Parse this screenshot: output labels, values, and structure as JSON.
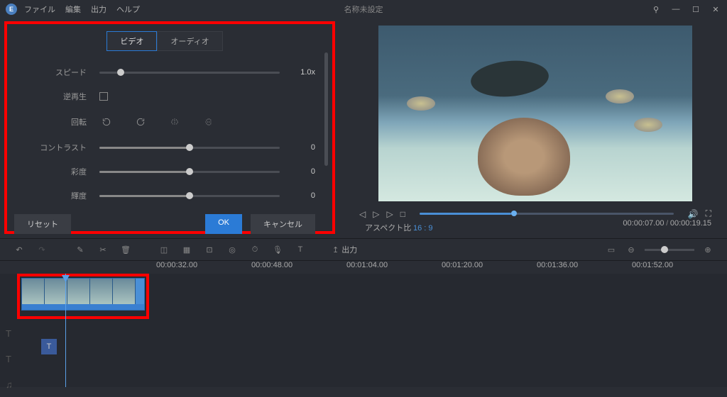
{
  "titlebar": {
    "logo": "E",
    "menu": [
      "ファイル",
      "編集",
      "出力",
      "ヘルプ"
    ],
    "title": "名称未設定"
  },
  "panel": {
    "tabs": {
      "video": "ビデオ",
      "audio": "オーディオ"
    },
    "labels": {
      "speed": "スピード",
      "reverse": "逆再生",
      "rotate": "回転",
      "contrast": "コントラスト",
      "saturation": "彩度",
      "brightness": "輝度"
    },
    "speed_val": "1.0x",
    "contrast_val": "0",
    "saturation_val": "0",
    "brightness_val": "0",
    "btn_reset": "リセット",
    "btn_ok": "OK",
    "btn_cancel": "キャンセル"
  },
  "preview": {
    "aspect_label": "アスペクト比",
    "aspect_val": "16 : 9",
    "time_cur": "00:00:07.00",
    "time_total": "00:00:19.15"
  },
  "toolbar": {
    "export": "出力"
  },
  "ruler": [
    "00:00:32.00",
    "00:00:48.00",
    "00:01:04.00",
    "00:01:20.00",
    "00:01:36.00",
    "00:01:52.00"
  ],
  "text_clip": "T"
}
